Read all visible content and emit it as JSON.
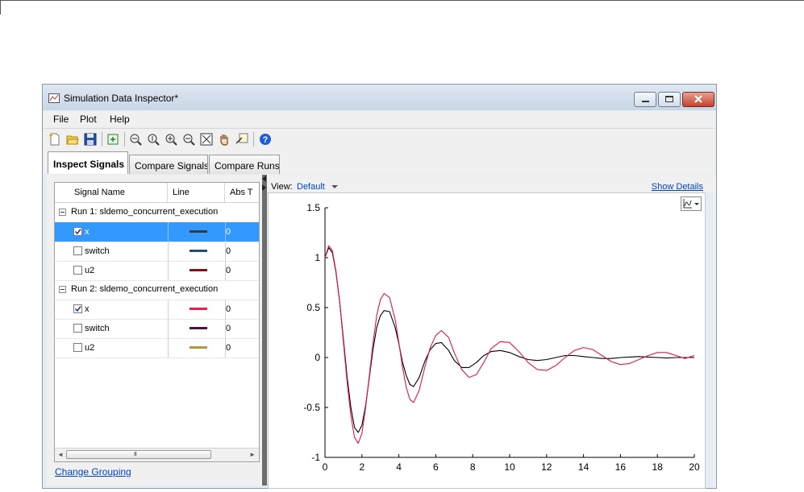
{
  "window": {
    "title": "Simulation Data Inspector*"
  },
  "menu": [
    "File",
    "Plot",
    "Help"
  ],
  "toolbar_icons": [
    "new-session-icon",
    "open-icon",
    "save-icon",
    "import-icon",
    "zoom-in-time-icon",
    "zoom-in-y-icon",
    "zoom-in-icon",
    "zoom-out-icon",
    "fit-to-view-icon",
    "pan-icon",
    "data-cursor-icon",
    "help-icon"
  ],
  "tabs": [
    "Inspect Signals",
    "Compare Signals",
    "Compare Runs"
  ],
  "signal_table": {
    "columns": [
      "Signal Name",
      "Line",
      "Abs T"
    ],
    "runs": [
      {
        "label": "Run 1: sldemo_concurrent_execution",
        "signals": [
          {
            "name": "x",
            "checked": true,
            "selected": true,
            "color": "#3a3a3a",
            "abs": "0"
          },
          {
            "name": "switch",
            "checked": false,
            "selected": false,
            "color": "#1f4e79",
            "abs": "0"
          },
          {
            "name": "u2",
            "checked": false,
            "selected": false,
            "color": "#7a1717",
            "abs": "0"
          }
        ]
      },
      {
        "label": "Run 2: sldemo_concurrent_execution",
        "signals": [
          {
            "name": "x",
            "checked": true,
            "selected": false,
            "color": "#e8204b",
            "abs": "0"
          },
          {
            "name": "switch",
            "checked": false,
            "selected": false,
            "color": "#4b1346",
            "abs": "0"
          },
          {
            "name": "u2",
            "checked": false,
            "selected": false,
            "color": "#b7973a",
            "abs": "0"
          }
        ]
      }
    ],
    "scroll_grip": "III"
  },
  "change_grouping": "Change Grouping",
  "view": {
    "label": "View:",
    "selected": "Default",
    "show_details": "Show Details"
  },
  "chart_data": {
    "type": "line",
    "title": "",
    "xlabel": "",
    "ylabel": "",
    "xlim": [
      0,
      20
    ],
    "ylim": [
      -1,
      1.5
    ],
    "xticks": [
      0,
      2,
      4,
      6,
      8,
      10,
      12,
      14,
      16,
      18,
      20
    ],
    "yticks": [
      -1,
      -0.5,
      0,
      0.5,
      1,
      1.5
    ],
    "ytick_labels": [
      "-1",
      "-0.5",
      "0",
      "0.5",
      "1",
      "1.5"
    ],
    "grid": false,
    "series": [
      {
        "color": "#000000",
        "x": [
          0,
          0.2,
          0.4,
          0.6,
          0.8,
          1.0,
          1.2,
          1.4,
          1.6,
          1.8,
          2.0,
          2.2,
          2.4,
          2.6,
          2.8,
          3.0,
          3.2,
          3.5,
          3.8,
          4.0,
          4.2,
          4.4,
          4.6,
          4.8,
          5.1,
          5.4,
          5.7,
          6.0,
          6.3,
          6.7,
          7.0,
          7.4,
          7.8,
          8.2,
          8.6,
          9.0,
          9.5,
          10.0,
          10.5,
          11.0,
          11.5,
          12.0,
          12.5,
          13.0,
          13.5,
          14.0,
          14.5,
          15.0,
          15.5,
          16.0,
          16.5,
          17.0,
          17.5,
          18.0,
          18.5,
          19.0,
          19.5,
          20.0
        ],
        "y": [
          1.0,
          1.1,
          1.05,
          0.85,
          0.55,
          0.18,
          -0.2,
          -0.5,
          -0.7,
          -0.75,
          -0.68,
          -0.48,
          -0.2,
          0.08,
          0.3,
          0.42,
          0.47,
          0.46,
          0.3,
          0.14,
          -0.05,
          -0.18,
          -0.27,
          -0.29,
          -0.2,
          -0.04,
          0.08,
          0.14,
          0.15,
          0.07,
          -0.03,
          -0.1,
          -0.1,
          -0.05,
          0.02,
          0.06,
          0.07,
          0.05,
          0.01,
          -0.02,
          -0.03,
          -0.02,
          0.0,
          0.02,
          0.02,
          0.01,
          0.0,
          -0.01,
          -0.01,
          0.0,
          0.005,
          0.01,
          0.005,
          0.0,
          -0.005,
          0.0,
          0.0,
          0.0
        ]
      },
      {
        "color": "#e0174a",
        "x": [
          0,
          0.2,
          0.4,
          0.6,
          0.8,
          1.0,
          1.2,
          1.4,
          1.6,
          1.8,
          2.0,
          2.2,
          2.4,
          2.6,
          2.8,
          3.0,
          3.2,
          3.5,
          3.8,
          4.0,
          4.2,
          4.4,
          4.6,
          4.8,
          5.1,
          5.4,
          5.7,
          6.0,
          6.3,
          6.7,
          7.0,
          7.4,
          7.8,
          8.2,
          8.6,
          9.0,
          9.5,
          10.0,
          10.5,
          11.0,
          11.5,
          12.0,
          12.5,
          13.0,
          13.5,
          14.0,
          14.5,
          15.0,
          15.5,
          16.0,
          16.5,
          17.0,
          17.5,
          18.0,
          18.5,
          19.0,
          19.5,
          20.0
        ],
        "y": [
          1.0,
          1.12,
          1.07,
          0.86,
          0.55,
          0.15,
          -0.25,
          -0.58,
          -0.8,
          -0.86,
          -0.76,
          -0.5,
          -0.18,
          0.14,
          0.42,
          0.58,
          0.64,
          0.6,
          0.38,
          0.15,
          -0.1,
          -0.3,
          -0.42,
          -0.45,
          -0.33,
          -0.1,
          0.1,
          0.22,
          0.27,
          0.2,
          0.05,
          -0.12,
          -0.2,
          -0.17,
          -0.05,
          0.09,
          0.16,
          0.15,
          0.06,
          -0.05,
          -0.12,
          -0.13,
          -0.08,
          0.0,
          0.07,
          0.1,
          0.08,
          0.02,
          -0.04,
          -0.07,
          -0.06,
          -0.02,
          0.02,
          0.05,
          0.05,
          0.02,
          -0.01,
          0.02
        ]
      }
    ]
  }
}
